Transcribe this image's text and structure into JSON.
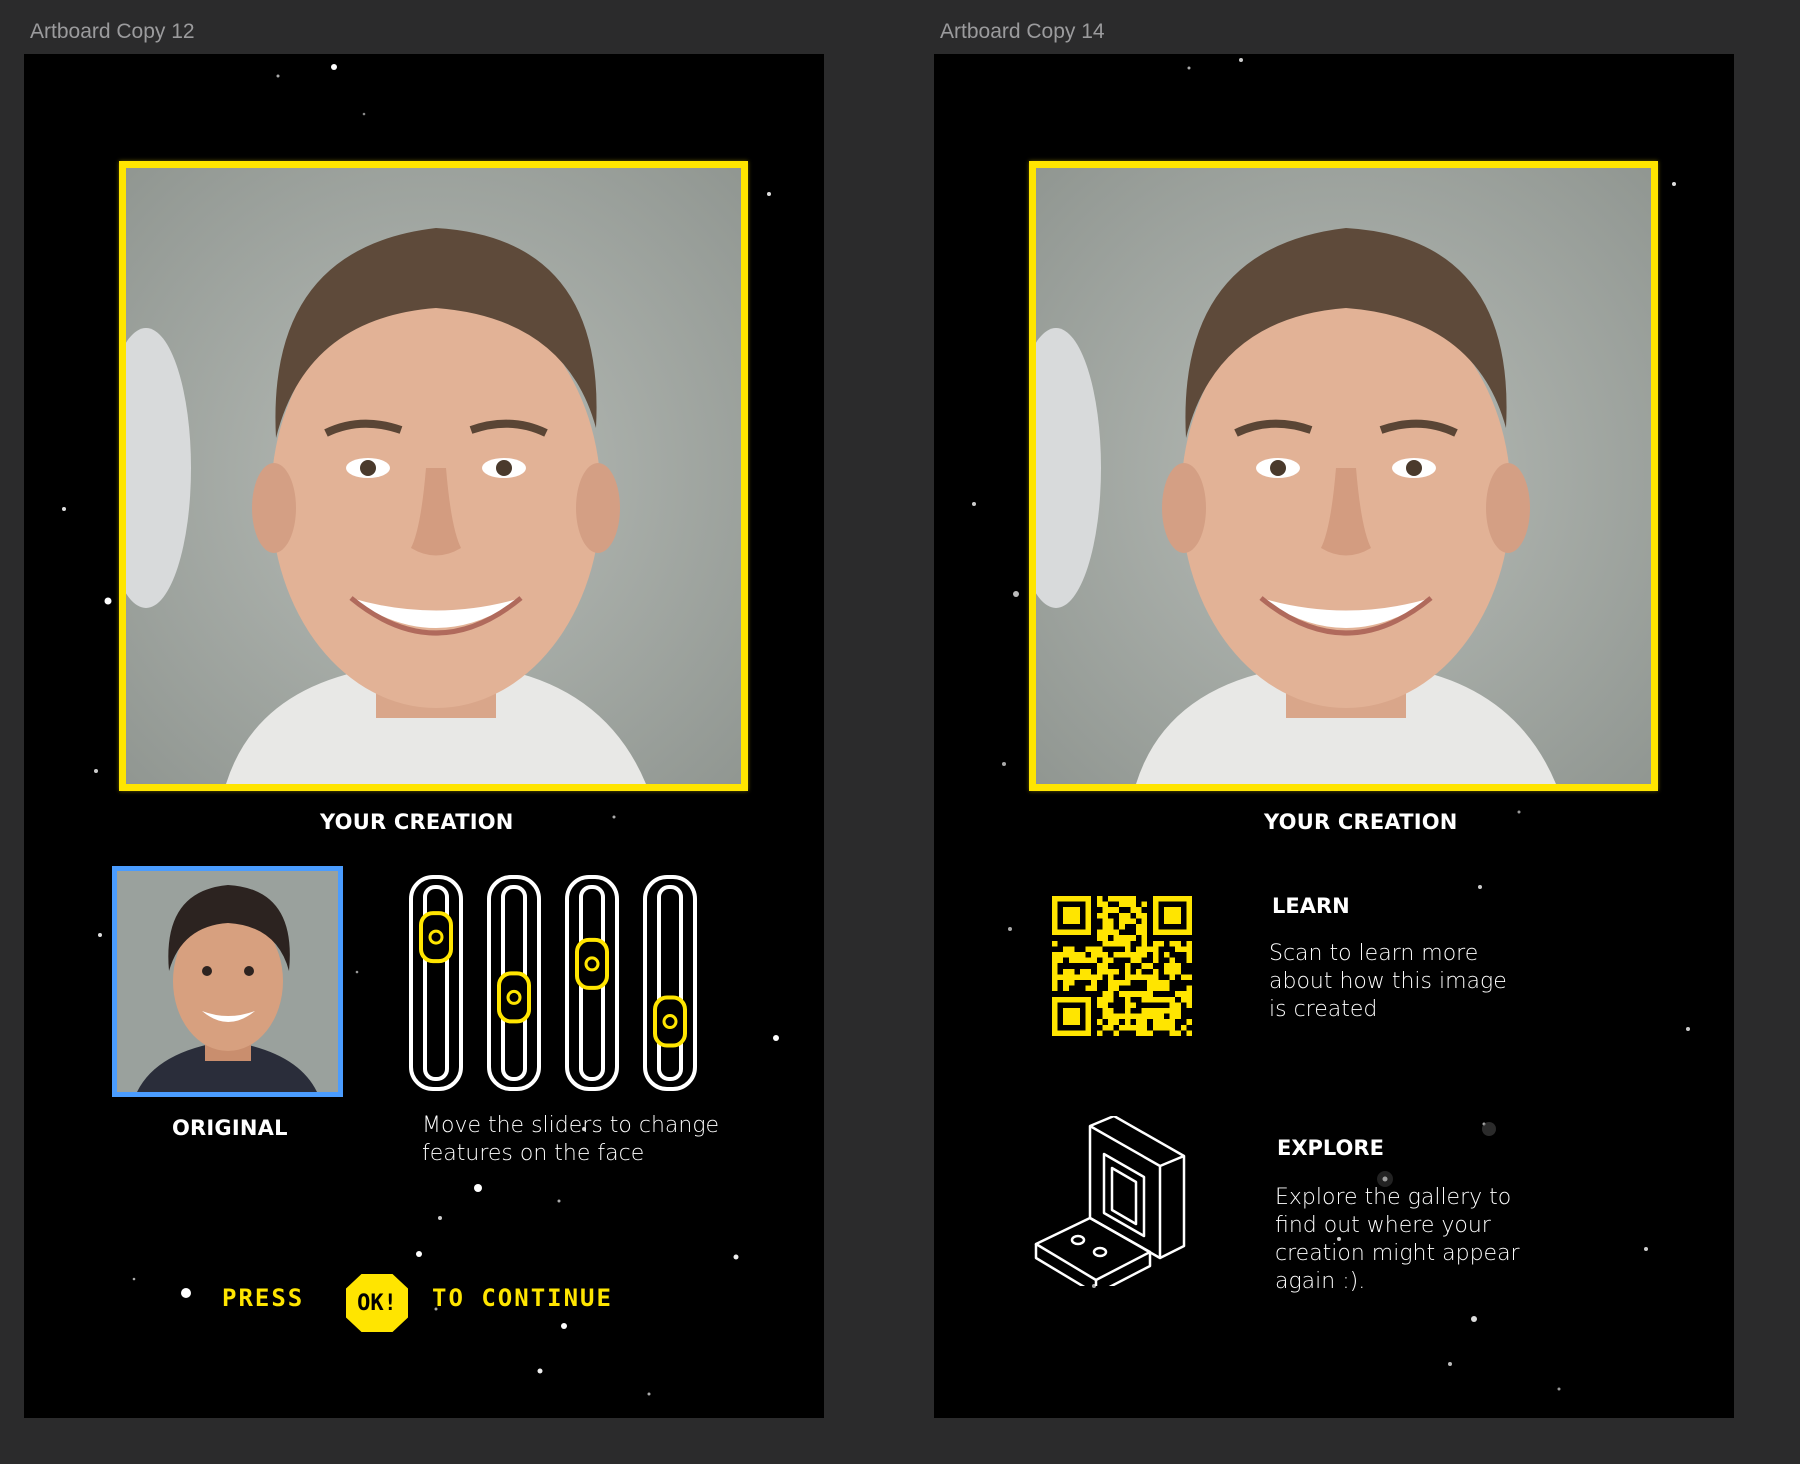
{
  "artboards": [
    {
      "label": "Artboard Copy 12"
    },
    {
      "label": "Artboard Copy 14"
    }
  ],
  "left": {
    "creation_caption": "YOUR CREATION",
    "original_caption": "ORIGINAL",
    "slider_hint": [
      "Move the sliders to change",
      "features on the face"
    ],
    "sliders": [
      0.15,
      0.6,
      0.35,
      0.78
    ],
    "press_text": "PRESS",
    "ok_label": "OK!",
    "continue_text": "TO CONTINUE"
  },
  "right": {
    "creation_caption": "YOUR CREATION",
    "learn_heading": "LEARN",
    "learn_text": [
      "Scan to learn more",
      "about how this image",
      "is created"
    ],
    "explore_heading": "EXPLORE",
    "explore_text": [
      "Explore the gallery to",
      "find out where your",
      "creation might appear",
      "again :)."
    ]
  },
  "colors": {
    "accent_yellow": "#ffe500",
    "original_frame_blue": "#4a9cff",
    "background": "#000000",
    "canvas": "#2b2b2c"
  },
  "icons": [
    "qr-code-icon",
    "arcade-cabinet-icon",
    "slider-icon",
    "ok-button-icon"
  ]
}
